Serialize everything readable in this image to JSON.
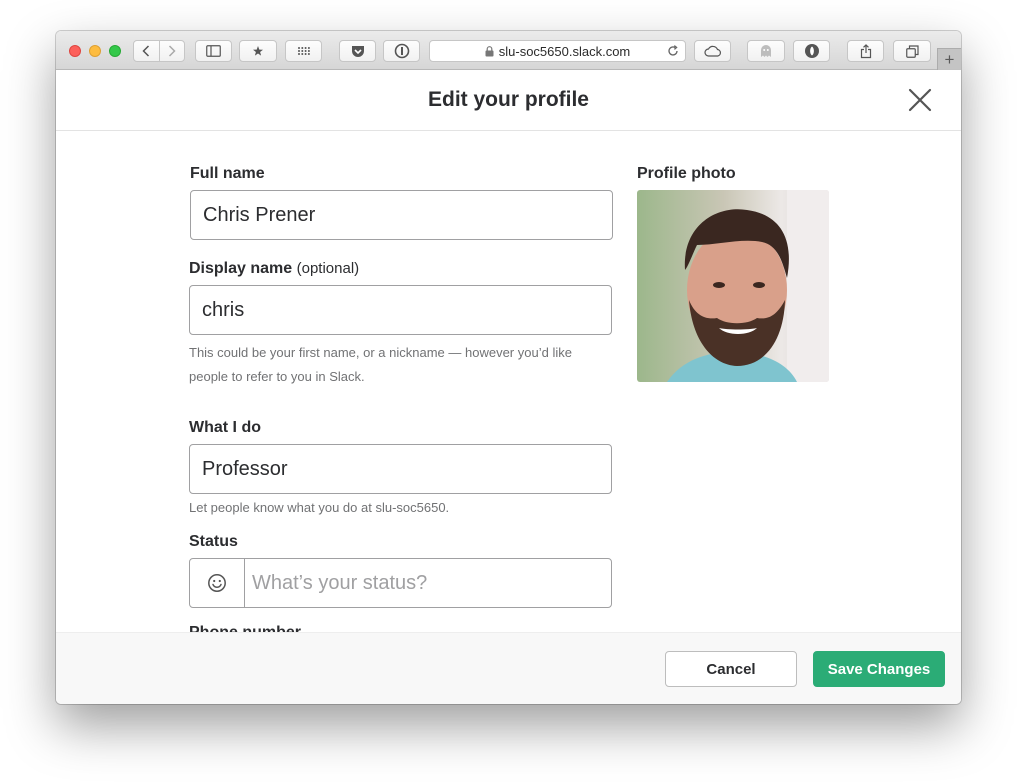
{
  "browser": {
    "url": "slu-soc5650.slack.com",
    "new_tab_label": "+"
  },
  "modal": {
    "title": "Edit your profile",
    "close_icon": "close-icon"
  },
  "form": {
    "full_name": {
      "label": "Full name",
      "value": "Chris Prener"
    },
    "display_name": {
      "label": "Display name",
      "label_suffix": "(optional)",
      "value": "chris",
      "hint": "This could be your first name, or a nickname — however you’d like people to refer to you in Slack."
    },
    "what_i_do": {
      "label": "What I do",
      "value": "Professor",
      "hint": "Let people know what you do at slu-soc5650."
    },
    "status": {
      "label": "Status",
      "placeholder": "What’s your status?",
      "emoji_icon": "smiley-icon"
    },
    "phone": {
      "label": "Phone number"
    },
    "profile_photo": {
      "label": "Profile photo"
    }
  },
  "footer": {
    "cancel_label": "Cancel",
    "save_label": "Save Changes"
  },
  "colors": {
    "save_button": "#2bac76",
    "close_red": "#fc605b",
    "minimize_yellow": "#fdbc40",
    "zoom_green": "#34c84a"
  }
}
